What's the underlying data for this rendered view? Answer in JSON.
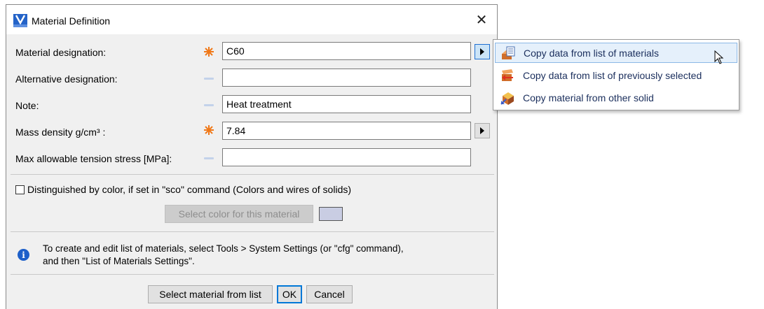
{
  "window": {
    "title": "Material Definition",
    "close_glyph": "✕",
    "icon": "app-v-icon"
  },
  "form": {
    "material_designation": {
      "label": "Material designation:",
      "value": "C60",
      "required": true
    },
    "alternative_designation": {
      "label": "Alternative designation:",
      "value": "",
      "required": false
    },
    "note": {
      "label": "Note:",
      "value": "Heat treatment",
      "required": false
    },
    "mass_density": {
      "label": "Mass density g/cm³ :",
      "value": "7.84",
      "required": true
    },
    "max_tension": {
      "label": "Max allowable tension stress [MPa]:",
      "value": "",
      "required": false
    }
  },
  "color_option": {
    "checkbox_label": "Distinguished by color, if set in \"sco\" command (Colors and wires of solids)",
    "checked": false,
    "select_color_button": "Select color for this material",
    "swatch_color": "#c9cde3"
  },
  "info": {
    "line1": "To create and edit list of materials, select Tools > System Settings (or \"cfg\" command),",
    "line2": "and then \"List of Materials Settings\"."
  },
  "buttons": {
    "select_from_list": "Select material from list",
    "ok": "OK",
    "cancel": "Cancel"
  },
  "popup_menu": {
    "items": [
      {
        "label": "Copy data from list of materials",
        "icon": "material-list-icon",
        "hover": true
      },
      {
        "label": "Copy data from list of previously selected",
        "icon": "previous-selection-icon",
        "hover": false
      },
      {
        "label": "Copy material from other solid",
        "icon": "solid-copy-icon",
        "hover": false
      }
    ]
  },
  "colors": {
    "accent": "#0078d7",
    "required_mark": "#f07818",
    "optional_mark": "#c3d2ea",
    "info_icon": "#1d5fc9"
  }
}
